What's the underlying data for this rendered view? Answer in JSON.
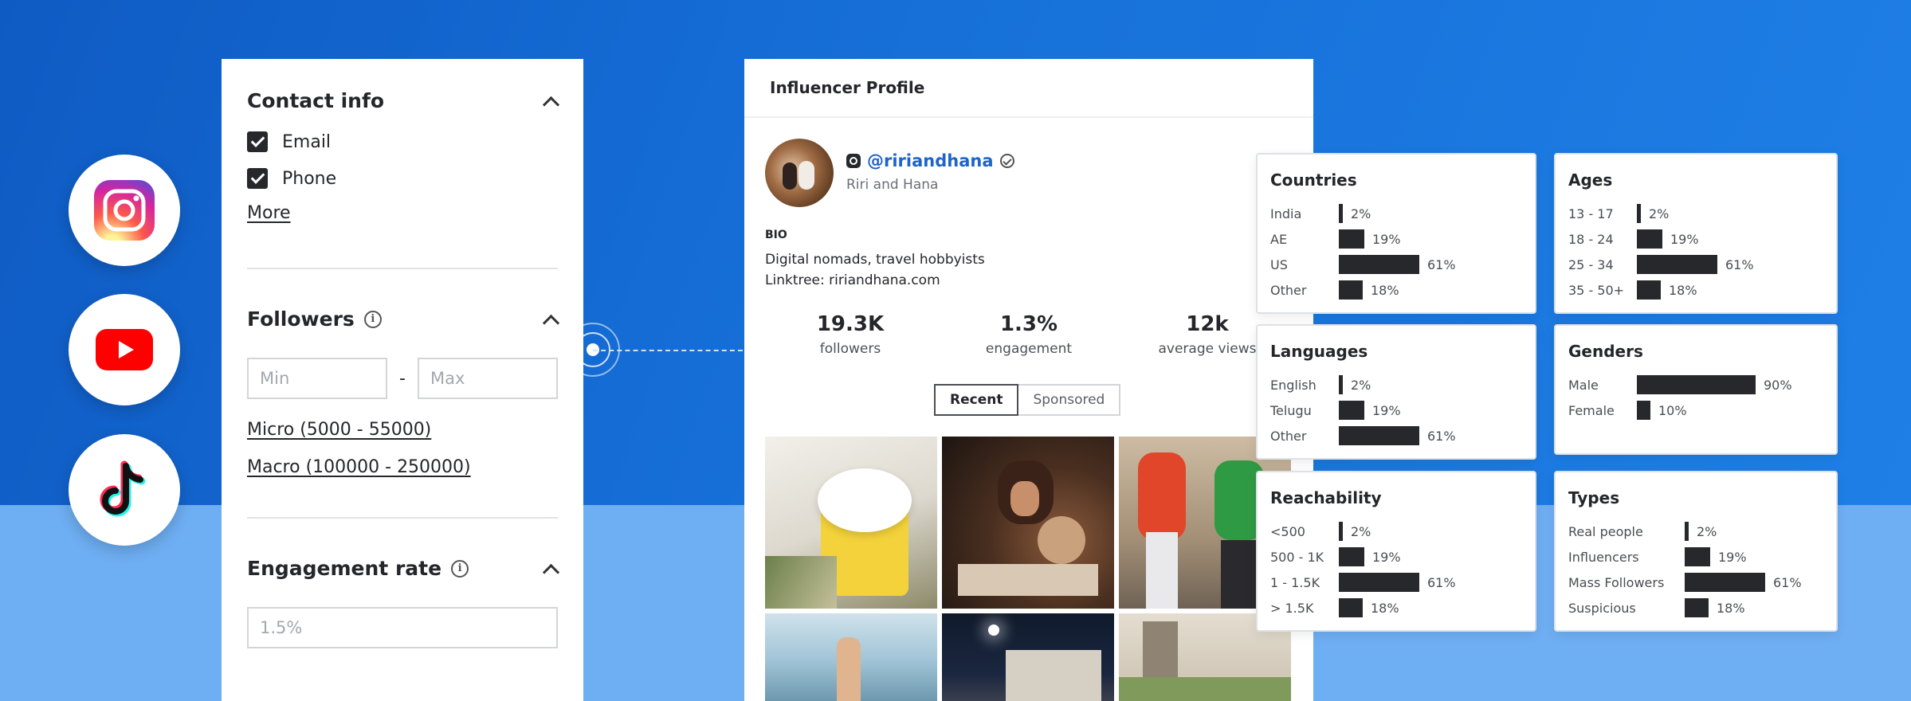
{
  "filters": {
    "contact": {
      "title": "Contact info",
      "options": [
        "Email",
        "Phone"
      ],
      "more_label": "More"
    },
    "followers": {
      "title": "Followers",
      "min_placeholder": "Min",
      "max_placeholder": "Max",
      "separator": "-",
      "presets": [
        "Micro (5000 - 55000)",
        "Macro (100000 - 250000)"
      ]
    },
    "engagement": {
      "title": "Engagement rate",
      "placeholder": "1.5%"
    }
  },
  "social_icons": [
    "instagram-icon",
    "youtube-icon",
    "tiktok-icon"
  ],
  "profile": {
    "header": "Influencer Profile",
    "handle": "@ririandhana",
    "display_name": "Riri and Hana",
    "bio_label": "BIO",
    "bio_lines": [
      "Digital nomads, travel hobbyists",
      "Linktree: ririandhana.com"
    ],
    "stats": [
      {
        "value": "19.3K",
        "label": "followers"
      },
      {
        "value": "1.3%",
        "label": "engagement"
      },
      {
        "value": "12k",
        "label": "average views"
      }
    ],
    "tabs": [
      "Recent",
      "Sponsored"
    ],
    "active_tab": "Recent"
  },
  "audience": {
    "countries": {
      "title": "Countries",
      "rows": [
        {
          "label": "India",
          "percent": 2,
          "text": "2%"
        },
        {
          "label": "AE",
          "percent": 19,
          "text": "19%"
        },
        {
          "label": "US",
          "percent": 61,
          "text": "61%"
        },
        {
          "label": "Other",
          "percent": 18,
          "text": "18%"
        }
      ]
    },
    "ages": {
      "title": "Ages",
      "rows": [
        {
          "label": "13 - 17",
          "percent": 2,
          "text": "2%"
        },
        {
          "label": "18 - 24",
          "percent": 19,
          "text": "19%"
        },
        {
          "label": "25 - 34",
          "percent": 61,
          "text": "61%"
        },
        {
          "label": "35 - 50+",
          "percent": 18,
          "text": "18%"
        }
      ]
    },
    "languages": {
      "title": "Languages",
      "rows": [
        {
          "label": "English",
          "percent": 2,
          "text": "2%"
        },
        {
          "label": "Telugu",
          "percent": 19,
          "text": "19%"
        },
        {
          "label": "Other",
          "percent": 61,
          "text": "61%"
        }
      ]
    },
    "genders": {
      "title": "Genders",
      "rows": [
        {
          "label": "Male",
          "percent": 90,
          "text": "90%"
        },
        {
          "label": "Female",
          "percent": 10,
          "text": "10%"
        }
      ]
    },
    "reachability": {
      "title": "Reachability",
      "rows": [
        {
          "label": "<500",
          "percent": 2,
          "text": "2%"
        },
        {
          "label": "500 - 1K",
          "percent": 19,
          "text": "19%"
        },
        {
          "label": "1 - 1.5K",
          "percent": 61,
          "text": "61%"
        },
        {
          "label": "> 1.5K",
          "percent": 18,
          "text": "18%"
        }
      ]
    },
    "types": {
      "title": "Types",
      "rows": [
        {
          "label": "Real people",
          "percent": 2,
          "text": "2%"
        },
        {
          "label": "Influencers",
          "percent": 19,
          "text": "19%"
        },
        {
          "label": "Mass Followers",
          "percent": 61,
          "text": "61%"
        },
        {
          "label": "Suspicious",
          "percent": 18,
          "text": "18%"
        }
      ]
    }
  },
  "colors": {
    "background_blue": "#1670d8",
    "background_light_blue": "#6eaef2",
    "bar": "#26282c",
    "link_blue": "#1f64c8"
  }
}
